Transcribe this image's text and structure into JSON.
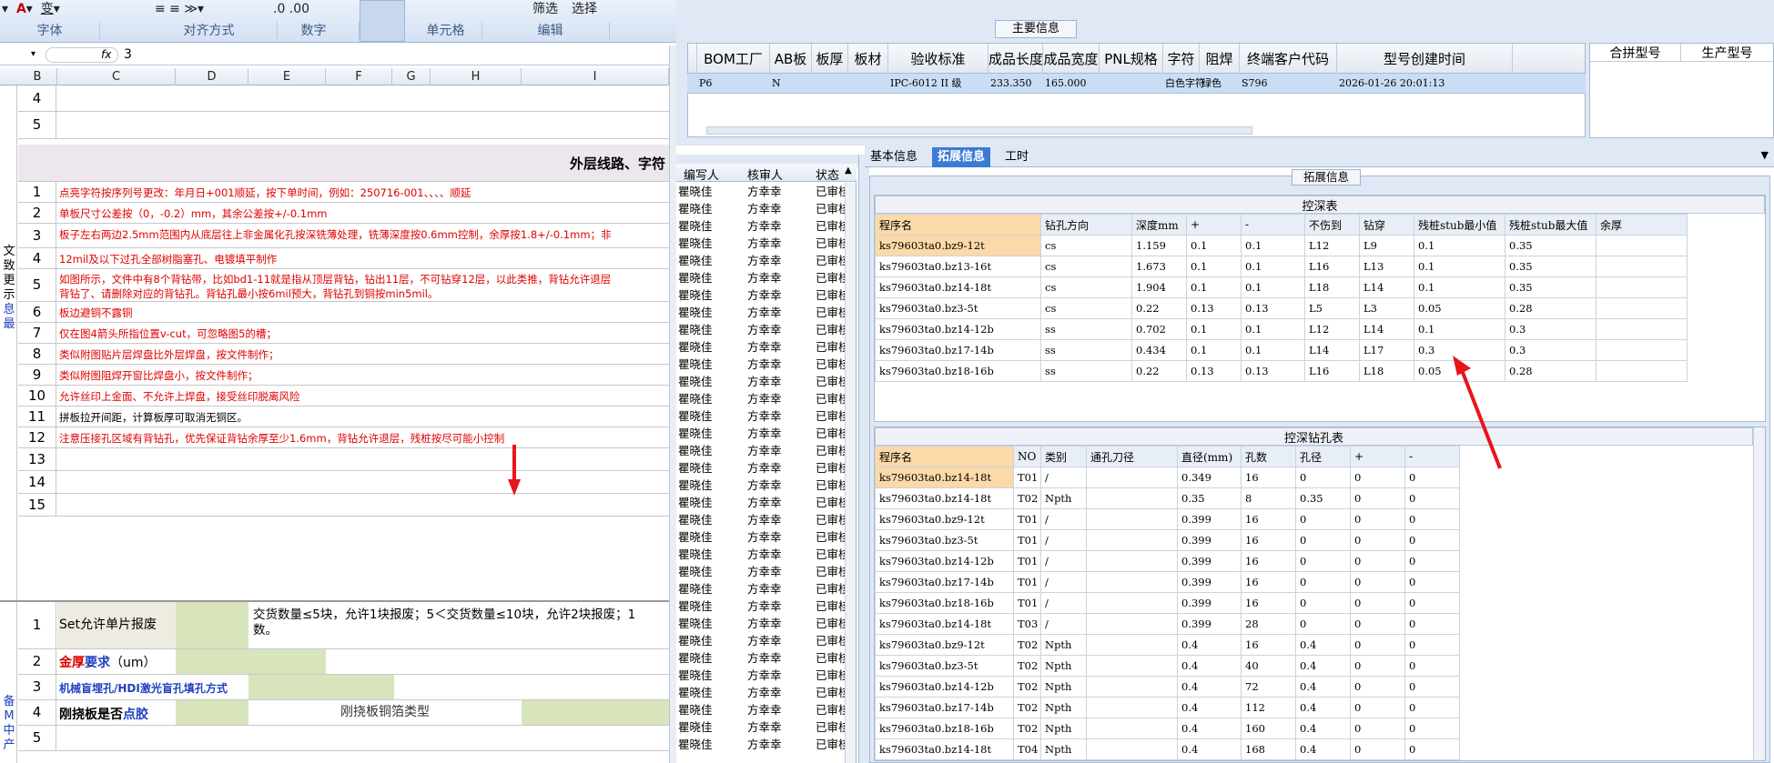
{
  "ribbon": {
    "groups": [
      "字体",
      "对齐方式",
      "数字",
      "单元格",
      "编辑"
    ],
    "filter": "筛选",
    "select": "选择"
  },
  "formula": {
    "value": "3",
    "fx": "fx"
  },
  "columns": [
    "B",
    "C",
    "D",
    "E",
    "F",
    "G",
    "H",
    "I"
  ],
  "rows_top": [
    {
      "n": "4"
    },
    {
      "n": "5"
    }
  ],
  "section_title": "外层线路、字符",
  "side_text1": [
    "文",
    "致",
    "更",
    "示",
    "息",
    "最"
  ],
  "notes": [
    {
      "n": "1",
      "t": "点亮字符按序列号更改：年月日+001顺延，按下单时间，例如：250716-001、、、、顺延"
    },
    {
      "n": "2",
      "t": "单板尺寸公差按（0，-0.2）mm，其余公差按+/-0.1mm"
    },
    {
      "n": "3",
      "t": "板子左右两边2.5mm范围内从底层往上非金属化孔按深铣薄处理，铣薄深度按0.6mm控制，余厚按1.8+/-0.1mm；非"
    },
    {
      "n": "4",
      "t": "12mil及以下过孔全部树脂塞孔、电镀填平制作"
    },
    {
      "n": "5",
      "t": "如图所示，文件中有8个背钻带，比如bd1-11就是指从顶层背钻，钻出11层，不可钻穿12层，以此类推，背钻允许退层",
      "t2": "背钻了、请删除对应的背钻孔。背钻孔最小按6mil预大，背钻孔到铜按min5mil。"
    },
    {
      "n": "6",
      "t": "板边避铜不露铜"
    },
    {
      "n": "7",
      "t": "仅在图4箭头所指位置v-cut，可忽略图5的槽；"
    },
    {
      "n": "8",
      "t": "类似附图贴片层焊盘比外层焊盘，按文件制作；"
    },
    {
      "n": "9",
      "t": "类似附图阻焊开窗比焊盘小，按文件制作；"
    },
    {
      "n": "10",
      "t": "允许丝印上金面、不允许上焊盘，接受丝印脱离风险"
    },
    {
      "n": "11",
      "t": "拼板拉开间距，计算板厚可取消无铜区。",
      "black": true
    },
    {
      "n": "12",
      "t": "注意压接孔区域有背钻孔，优先保证背钻余厚至少1.6mm，背钻允许退层，残桩按尽可能小控制"
    },
    {
      "n": "13",
      "t": ""
    },
    {
      "n": "14",
      "t": ""
    },
    {
      "n": "15",
      "t": ""
    }
  ],
  "lower": {
    "r1": {
      "n": "1",
      "label": "Set允许单片报废",
      "desc": "交货数量≤5块，允许1块报废；5＜交货数量≤10块，允许2块报废；1",
      "desc2": "数。"
    },
    "r2": {
      "n": "2",
      "label_red": "金厚",
      "label_blue": "要求",
      "label_rest": "（um）"
    },
    "r3": {
      "n": "3",
      "label": "机械盲埋孔/HDI激光盲孔填孔方式"
    },
    "r4": {
      "n": "4",
      "label": "刚挠板是否",
      "label_blue": "点胶",
      "mid": "刚挠板铜箔类型"
    },
    "r5": {
      "n": "5"
    }
  },
  "side_text2": [
    "备",
    "M",
    "中",
    "产"
  ],
  "main": {
    "title": "主要信息",
    "headers": [
      "BOM工厂",
      "AB板",
      "板厚",
      "板材",
      "验收标准",
      "成品长度",
      "成品宽度",
      "PNL规格",
      "字符",
      "阻焊",
      "终端客户代码",
      "型号创建时间"
    ],
    "row": [
      "P6",
      "N",
      "",
      "",
      "IPC-6012 II 级",
      "233.350",
      "165.000",
      "",
      "白色字符",
      "绿色",
      "S796",
      "2026-01-26 20:01:13"
    ],
    "right_headers": [
      "合拼型号",
      "生产型号"
    ]
  },
  "midlist": {
    "headers": [
      "编写人",
      "核审人",
      "状态"
    ],
    "writer": "瞿晓佳",
    "reviewer": "方幸幸",
    "status": "已审核"
  },
  "tabs": [
    "基本信息",
    "拓展信息",
    "工时"
  ],
  "ext": {
    "title": "拓展信息",
    "t1": {
      "title": "控深表",
      "headers": [
        "程序名",
        "钻孔方向",
        "深度mm",
        "+",
        "-",
        "不伤到",
        "钻穿",
        "残桩stub最小值",
        "残桩stub最大值",
        "余厚"
      ],
      "rows": [
        [
          "ks79603ta0.bz9-12t",
          "cs",
          "1.159",
          "0.1",
          "0.1",
          "L12",
          "L9",
          "0.1",
          "0.35",
          ""
        ],
        [
          "ks79603ta0.bz13-16t",
          "cs",
          "1.673",
          "0.1",
          "0.1",
          "L16",
          "L13",
          "0.1",
          "0.35",
          ""
        ],
        [
          "ks79603ta0.bz14-18t",
          "cs",
          "1.904",
          "0.1",
          "0.1",
          "L18",
          "L14",
          "0.1",
          "0.35",
          ""
        ],
        [
          "ks79603ta0.bz3-5t",
          "cs",
          "0.22",
          "0.13",
          "0.13",
          "L5",
          "L3",
          "0.05",
          "0.28",
          ""
        ],
        [
          "ks79603ta0.bz14-12b",
          "ss",
          "0.702",
          "0.1",
          "0.1",
          "L12",
          "L14",
          "0.1",
          "0.3",
          ""
        ],
        [
          "ks79603ta0.bz17-14b",
          "ss",
          "0.434",
          "0.1",
          "0.1",
          "L14",
          "L17",
          "0.3",
          "0.3",
          ""
        ],
        [
          "ks79603ta0.bz18-16b",
          "ss",
          "0.22",
          "0.13",
          "0.13",
          "L16",
          "L18",
          "0.05",
          "0.28",
          ""
        ]
      ]
    },
    "t2": {
      "title": "控深钻孔表",
      "headers": [
        "程序名",
        "NO",
        "类别",
        "通孔刀径",
        "直径(mm)",
        "孔数",
        "孔径",
        "+",
        "-"
      ],
      "rows": [
        [
          "ks79603ta0.bz14-18t",
          "T01",
          "/",
          "",
          "0.349",
          "16",
          "0",
          "0",
          "0"
        ],
        [
          "ks79603ta0.bz14-18t",
          "T02",
          "Npth",
          "",
          "0.35",
          "8",
          "0.35",
          "0",
          "0"
        ],
        [
          "ks79603ta0.bz9-12t",
          "T01",
          "/",
          "",
          "0.399",
          "16",
          "0",
          "0",
          "0"
        ],
        [
          "ks79603ta0.bz3-5t",
          "T01",
          "/",
          "",
          "0.399",
          "16",
          "0",
          "0",
          "0"
        ],
        [
          "ks79603ta0.bz14-12b",
          "T01",
          "/",
          "",
          "0.399",
          "16",
          "0",
          "0",
          "0"
        ],
        [
          "ks79603ta0.bz17-14b",
          "T01",
          "/",
          "",
          "0.399",
          "16",
          "0",
          "0",
          "0"
        ],
        [
          "ks79603ta0.bz18-16b",
          "T01",
          "/",
          "",
          "0.399",
          "16",
          "0",
          "0",
          "0"
        ],
        [
          "ks79603ta0.bz14-18t",
          "T03",
          "/",
          "",
          "0.399",
          "28",
          "0",
          "0",
          "0"
        ],
        [
          "ks79603ta0.bz9-12t",
          "T02",
          "Npth",
          "",
          "0.4",
          "16",
          "0.4",
          "0",
          "0"
        ],
        [
          "ks79603ta0.bz3-5t",
          "T02",
          "Npth",
          "",
          "0.4",
          "40",
          "0.4",
          "0",
          "0"
        ],
        [
          "ks79603ta0.bz14-12b",
          "T02",
          "Npth",
          "",
          "0.4",
          "72",
          "0.4",
          "0",
          "0"
        ],
        [
          "ks79603ta0.bz17-14b",
          "T02",
          "Npth",
          "",
          "0.4",
          "112",
          "0.4",
          "0",
          "0"
        ],
        [
          "ks79603ta0.bz18-16b",
          "T02",
          "Npth",
          "",
          "0.4",
          "160",
          "0.4",
          "0",
          "0"
        ],
        [
          "ks79603ta0.bz14-18t",
          "T04",
          "Npth",
          "",
          "0.4",
          "168",
          "0.4",
          "0",
          "0"
        ]
      ]
    }
  }
}
